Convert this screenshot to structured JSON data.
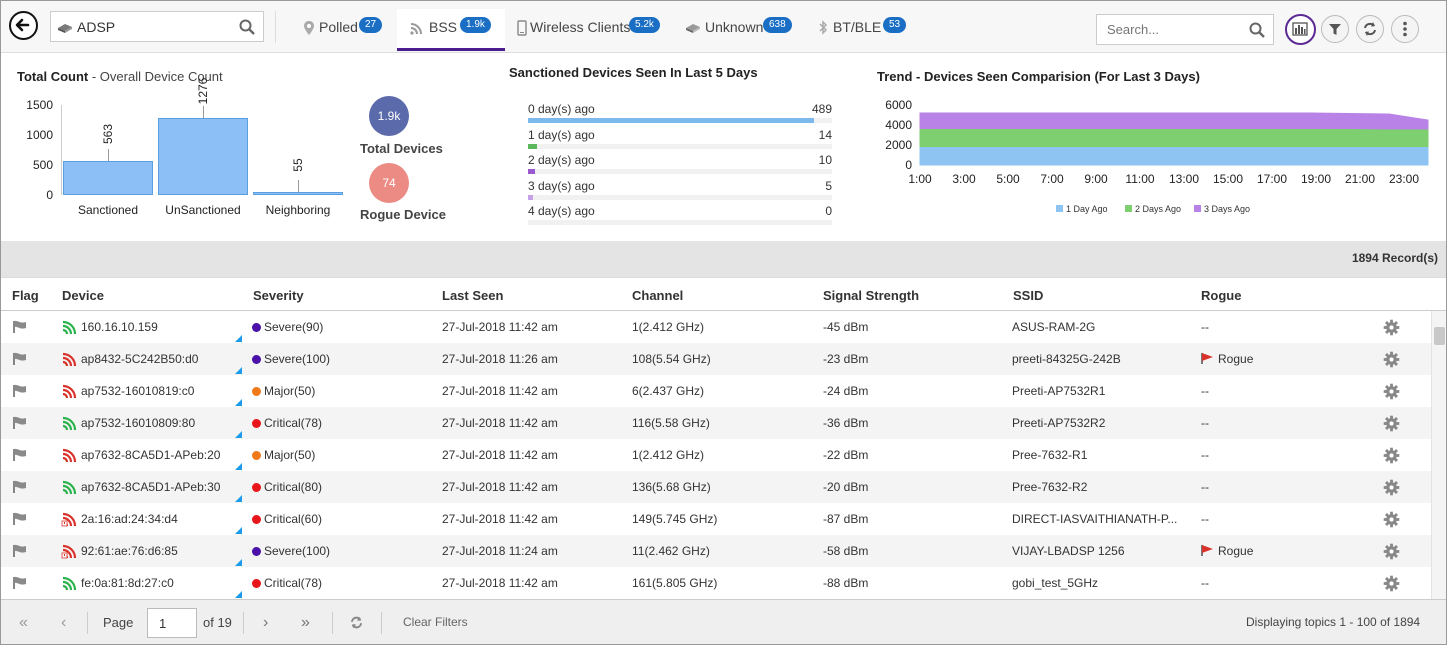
{
  "header": {
    "site_selector": {
      "label": "ADSP",
      "icon": "device-icon"
    },
    "tabs": [
      {
        "label": "Polled",
        "badge": "27",
        "icon": "pin-icon"
      },
      {
        "label": "BSS",
        "badge": "1.9k",
        "icon": "wifi-icon",
        "active": true
      },
      {
        "label": "Wireless Clients",
        "badge": "5.2k",
        "icon": "phone-icon"
      },
      {
        "label": "Unknown",
        "badge": "638",
        "icon": "device-icon"
      },
      {
        "label": "BT/BLE",
        "badge": "53",
        "icon": "bluetooth-icon"
      }
    ],
    "search_placeholder": "Search..."
  },
  "total_count": {
    "title": "Total Count",
    "subtitle": " - Overall Device Count",
    "total_devices_value": "1.9k",
    "total_devices_label": "Total Devices",
    "rogue_value": "74",
    "rogue_label": "Rogue Device"
  },
  "sanctioned_panel": {
    "title": "Sanctioned Devices Seen In Last 5 Days",
    "rows": [
      {
        "label": "0 day(s) ago",
        "value": "489",
        "fraction": 0.94,
        "color": "#7cb9ec"
      },
      {
        "label": "1 day(s) ago",
        "value": "14",
        "fraction": 0.03,
        "color": "#5cb85c"
      },
      {
        "label": "2 day(s) ago",
        "value": "10",
        "fraction": 0.022,
        "color": "#9b59d0"
      },
      {
        "label": "3 day(s) ago",
        "value": "5",
        "fraction": 0.01,
        "color": "#c7a0ea"
      },
      {
        "label": "4 day(s) ago",
        "value": "0",
        "fraction": 0,
        "color": "#7cb9ec"
      }
    ]
  },
  "trend_panel": {
    "title": "Trend - Devices Seen Comparision (For Last 3 Days)"
  },
  "chart_data": [
    {
      "type": "bar",
      "categories": [
        "Sanctioned",
        "UnSanctioned",
        "Neighboring"
      ],
      "values": [
        563,
        1276,
        55
      ],
      "ylim": [
        0,
        1500
      ],
      "yticks": [
        "0",
        "500",
        "1000",
        "1500"
      ],
      "color": "#8cbff5",
      "grid": false
    },
    {
      "type": "area",
      "x": [
        "1:00",
        "3:00",
        "5:00",
        "7:00",
        "9:00",
        "11:00",
        "13:00",
        "15:00",
        "17:00",
        "19:00",
        "21:00",
        "23:00"
      ],
      "ylim": [
        0,
        6000
      ],
      "yticks": [
        "0",
        "2000",
        "4000",
        "6000"
      ],
      "legend": "bottom",
      "stacked": true,
      "series": [
        {
          "name": "1 Day Ago",
          "color": "#8dc4f2",
          "values": [
            1850,
            1850,
            1850,
            1850,
            1850,
            1850,
            1850,
            1850,
            1850,
            1850,
            1850,
            1850,
            1850,
            1850
          ]
        },
        {
          "name": "2 Days Ago",
          "color": "#7dcf6f",
          "values": [
            1800,
            1800,
            1800,
            1800,
            1800,
            1800,
            1800,
            1800,
            1800,
            1800,
            1800,
            1800,
            1750,
            1750
          ]
        },
        {
          "name": "3 Days Ago",
          "color": "#b982e6",
          "values": [
            1550,
            1550,
            1550,
            1550,
            1550,
            1550,
            1550,
            1550,
            1550,
            1550,
            1550,
            1500,
            1500,
            900
          ]
        }
      ]
    }
  ],
  "records_label": "1894 Record(s)",
  "table": {
    "headers": [
      "Flag",
      "Device",
      "Severity",
      "Last Seen",
      "Channel",
      "Signal Strength",
      "SSID",
      "Rogue"
    ],
    "rows": [
      {
        "device": "160.16.10.159",
        "icon_color": "#2bb24c",
        "icon": "wifi-icon",
        "severity": "Severe(90)",
        "sev_color": "#4a12a8",
        "last_seen": "27-Jul-2018 11:42 am",
        "channel": "1(2.412 GHz)",
        "signal": "-45 dBm",
        "ssid": "ASUS-RAM-2G",
        "rogue": "--"
      },
      {
        "device": "ap8432-5C242B50:d0",
        "icon_color": "#d9322b",
        "icon": "wifi-icon",
        "severity": "Severe(100)",
        "sev_color": "#4a12a8",
        "last_seen": "27-Jul-2018 11:26 am",
        "channel": "108(5.54 GHz)",
        "signal": "-23 dBm",
        "ssid": "preeti-84325G-242B",
        "rogue": "Rogue"
      },
      {
        "device": "ap7532-16010819:c0",
        "icon_color": "#d9322b",
        "icon": "wifi-icon",
        "severity": "Major(50)",
        "sev_color": "#f07a1a",
        "last_seen": "27-Jul-2018 11:42 am",
        "channel": "6(2.437 GHz)",
        "signal": "-24 dBm",
        "ssid": "Preeti-AP7532R1",
        "rogue": "--"
      },
      {
        "device": "ap7532-16010809:80",
        "icon_color": "#2bb24c",
        "icon": "wifi-icon",
        "severity": "Critical(78)",
        "sev_color": "#e8161b",
        "last_seen": "27-Jul-2018 11:42 am",
        "channel": "116(5.58 GHz)",
        "signal": "-36 dBm",
        "ssid": "Preeti-AP7532R2",
        "rogue": "--"
      },
      {
        "device": "ap7632-8CA5D1-APeb:20",
        "icon_color": "#d9322b",
        "icon": "wifi-icon",
        "severity": "Major(50)",
        "sev_color": "#f07a1a",
        "last_seen": "27-Jul-2018 11:42 am",
        "channel": "1(2.412 GHz)",
        "signal": "-22 dBm",
        "ssid": "Pree-7632-R1",
        "rogue": "--"
      },
      {
        "device": "ap7632-8CA5D1-APeb:30",
        "icon_color": "#2bb24c",
        "icon": "wifi-icon",
        "severity": "Critical(80)",
        "sev_color": "#e8161b",
        "last_seen": "27-Jul-2018 11:42 am",
        "channel": "136(5.68 GHz)",
        "signal": "-20 dBm",
        "ssid": "Pree-7632-R2",
        "rogue": "--"
      },
      {
        "device": "2a:16:ad:24:34:d4",
        "icon_color": "#d9322b",
        "icon": "wifi-warning-icon",
        "severity": "Critical(60)",
        "sev_color": "#e8161b",
        "last_seen": "27-Jul-2018 11:42 am",
        "channel": "149(5.745 GHz)",
        "signal": "-87 dBm",
        "ssid": "DIRECT-IASVAITHIANATH-P...",
        "rogue": "--"
      },
      {
        "device": "92:61:ae:76:d6:85",
        "icon_color": "#d9322b",
        "icon": "wifi-warning-icon",
        "severity": "Severe(100)",
        "sev_color": "#4a12a8",
        "last_seen": "27-Jul-2018 11:24 am",
        "channel": "11(2.462 GHz)",
        "signal": "-58 dBm",
        "ssid": "VIJAY-LBADSP 1256",
        "rogue": "Rogue"
      },
      {
        "device": "fe:0a:81:8d:27:c0",
        "icon_color": "#2bb24c",
        "icon": "wifi-icon",
        "severity": "Critical(78)",
        "sev_color": "#e8161b",
        "last_seen": "27-Jul-2018 11:42 am",
        "channel": "161(5.805 GHz)",
        "signal": "-88 dBm",
        "ssid": "gobi_test_5GHz",
        "rogue": "--"
      }
    ]
  },
  "footer": {
    "page_label": "Page",
    "page_value": "1",
    "of_label": "of 19",
    "clear_filters": "Clear Filters",
    "displaying": "Displaying topics 1 - 100 of 1894"
  }
}
